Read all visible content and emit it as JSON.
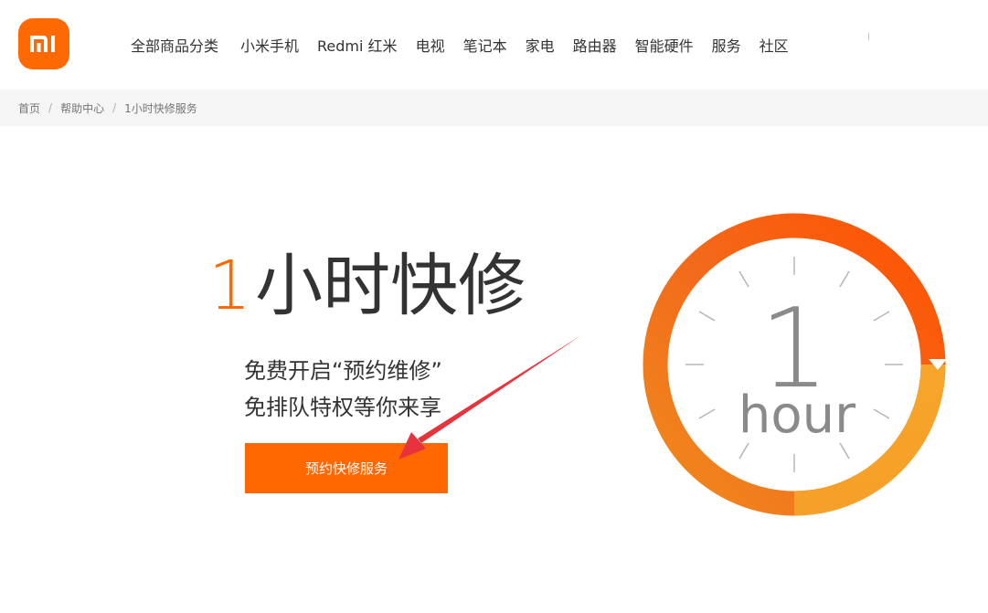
{
  "header": {
    "logo_text": "mi",
    "nav": [
      "全部商品分类",
      "小米手机",
      "Redmi 红米",
      "电视",
      "笔记本",
      "家电",
      "路由器",
      "智能硬件",
      "服务",
      "社区"
    ]
  },
  "breadcrumb": {
    "items": [
      "首页",
      "帮助中心",
      "1小时快修服务"
    ],
    "separator": "/"
  },
  "hero": {
    "title_number": "1",
    "title_text": "小时快修",
    "line1": "免费开启“预约维修”",
    "line2": "免排队特权等你来享",
    "cta_label": "预约快修服务"
  },
  "clock": {
    "number": "1",
    "unit": "hour",
    "ring_color_start": "#f7a52a",
    "ring_color_end": "#ff5a00"
  },
  "colors": {
    "brand": "#ff6900",
    "button": "#ff6700",
    "breadcrumb_bg": "#f5f5f5",
    "arrow": "#e8323c"
  }
}
